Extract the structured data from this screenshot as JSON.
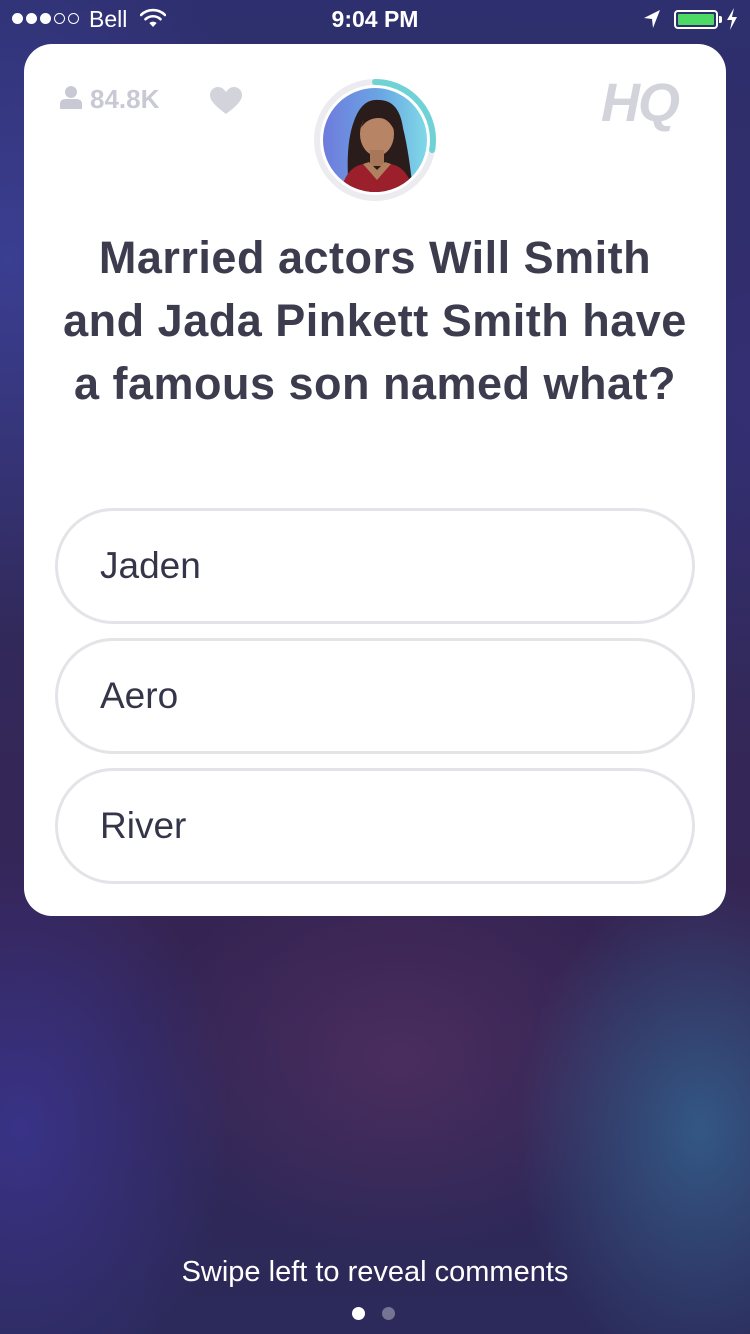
{
  "status_bar": {
    "signal_bars_filled": 3,
    "signal_bars_total": 5,
    "carrier": "Bell",
    "time": "9:04 PM",
    "battery_level": 1.0,
    "battery_color": "#4cd964"
  },
  "header": {
    "viewer_count": "84.8K",
    "logo_text": "HQ",
    "timer_color": "#6fd3d6"
  },
  "question": {
    "text": "Married actors Will Smith and Jada Pinkett Smith have a famous son named what?"
  },
  "answers": [
    {
      "label": "Jaden"
    },
    {
      "label": "Aero"
    },
    {
      "label": "River"
    }
  ],
  "footer": {
    "hint": "Swipe left to reveal comments",
    "page_count": 2,
    "active_page": 1
  }
}
